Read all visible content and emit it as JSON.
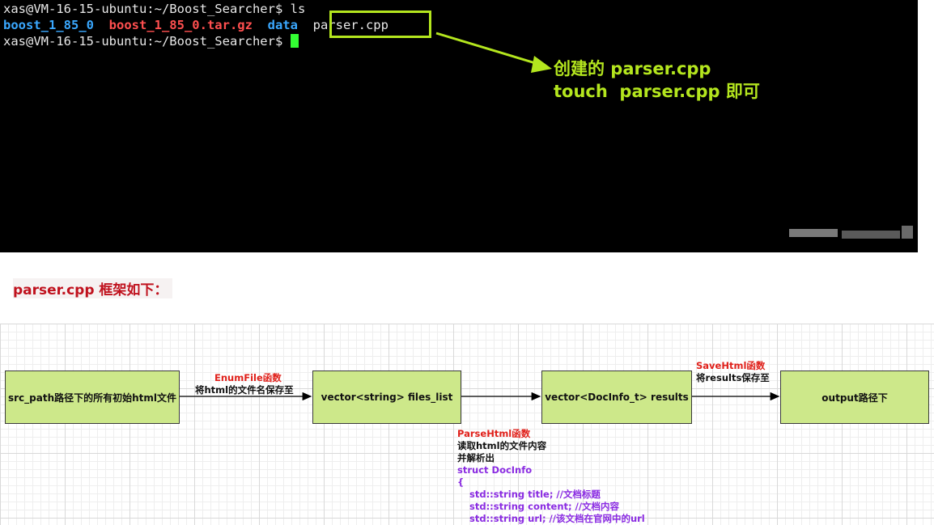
{
  "terminal": {
    "line1_prompt": "xas@VM-16-15-ubuntu:~/Boost_Searcher$ ",
    "line1_command": "ls",
    "ls_items": {
      "dir1": "boost_1_85_0",
      "archive": "boost_1_85_0.tar.gz",
      "dir2": "data",
      "file": "parser.cpp"
    },
    "line3_prompt": "xas@VM-16-15-ubuntu:~/Boost_Searcher$ ",
    "annotation_line1": "创建的 parser.cpp",
    "annotation_line2": "touch  parser.cpp 即可"
  },
  "heading": "parser.cpp 框架如下：",
  "diagram": {
    "nodes": {
      "src": "src_path路径下的所有初始html文件",
      "files_list": "vector<string> files_list",
      "results": "vector<DocInfo_t> results",
      "output": "output路径下"
    },
    "edge_enum": {
      "func": "EnumFile函数",
      "desc": "将html的文件名保存至"
    },
    "edge_save": {
      "func": "SaveHtml函数",
      "desc": "将results保存至"
    },
    "parse": {
      "func": "ParseHtml函数",
      "desc1": "读取html的文件内容",
      "desc2": "并解析出",
      "struct_decl": "struct DocInfo",
      "brace": "{",
      "field_title": "std::string title; //文档标题",
      "field_content": "std::string content; //文档内容",
      "field_url": "std::string url; //该文档在官网中的url"
    }
  },
  "colors": {
    "terminal_bg": "#000000",
    "dir_blue": "#3aa8ff",
    "archive_red": "#ff4f4f",
    "annotation_green": "#b4e61e",
    "node_fill": "#cde88a",
    "func_red": "#e0201a",
    "struct_purple": "#8a2be2"
  }
}
